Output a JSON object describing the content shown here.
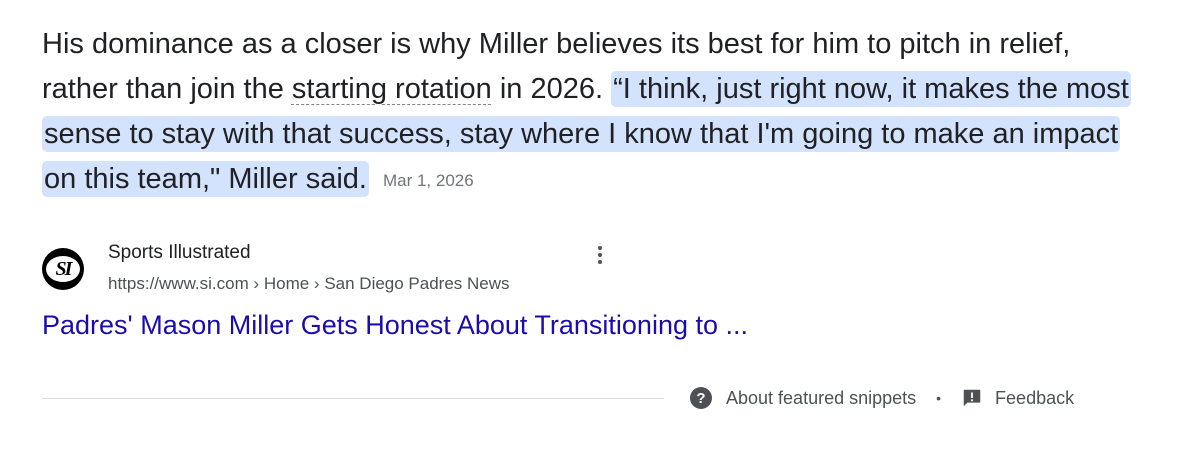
{
  "snippet": {
    "text_plain": "His dominance as a closer is why Miller believes its best for him to pitch in relief, rather than join the ",
    "term": "starting rotation",
    "text_mid": " in 2026. ",
    "quote_highlight": "“I think, just right now, it makes the most sense to stay with that success, stay where I know that I'm going to make an impact on this team,\" Miller said.",
    "date": "Mar 1, 2026"
  },
  "source": {
    "logo_text": "SI",
    "site_name": "Sports Illustrated",
    "url": "https://www.si.com › Home › San Diego Padres News",
    "more_icon": "more-vert-icon"
  },
  "result": {
    "title": "Padres' Mason Miller Gets Honest About Transitioning to ..."
  },
  "footer": {
    "about_label": "About featured snippets",
    "separator": "•",
    "feedback_label": "Feedback",
    "help_icon_glyph": "?"
  },
  "colors": {
    "link": "#1a0dab",
    "highlight": "#d3e3fd",
    "text": "#202124",
    "secondary": "#4d5156"
  }
}
